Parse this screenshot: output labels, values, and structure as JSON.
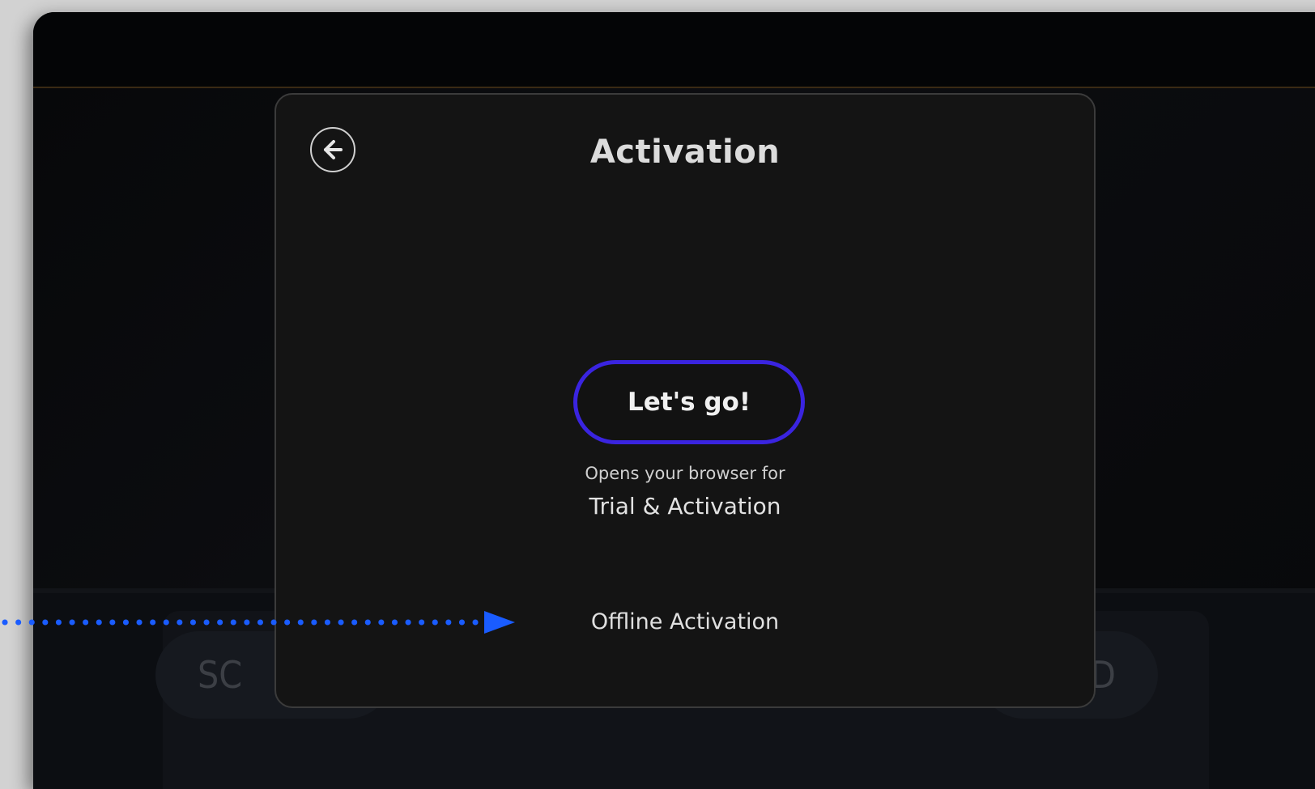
{
  "background": {
    "left_pill_text": "SC",
    "right_pill_text": "D"
  },
  "dialog": {
    "title": "Activation",
    "back_icon": "arrow-left-circle-icon",
    "primary_button_label": "Let's go!",
    "primary_button_border_color": "#3a24e0",
    "subtext_line1": "Opens your browser for",
    "subtext_line2": "Trial & Activation",
    "offline_link_label": "Offline Activation"
  },
  "annotation": {
    "arrow_color": "#1a5cff",
    "arrow_icon": "dotted-arrow-right-icon"
  }
}
